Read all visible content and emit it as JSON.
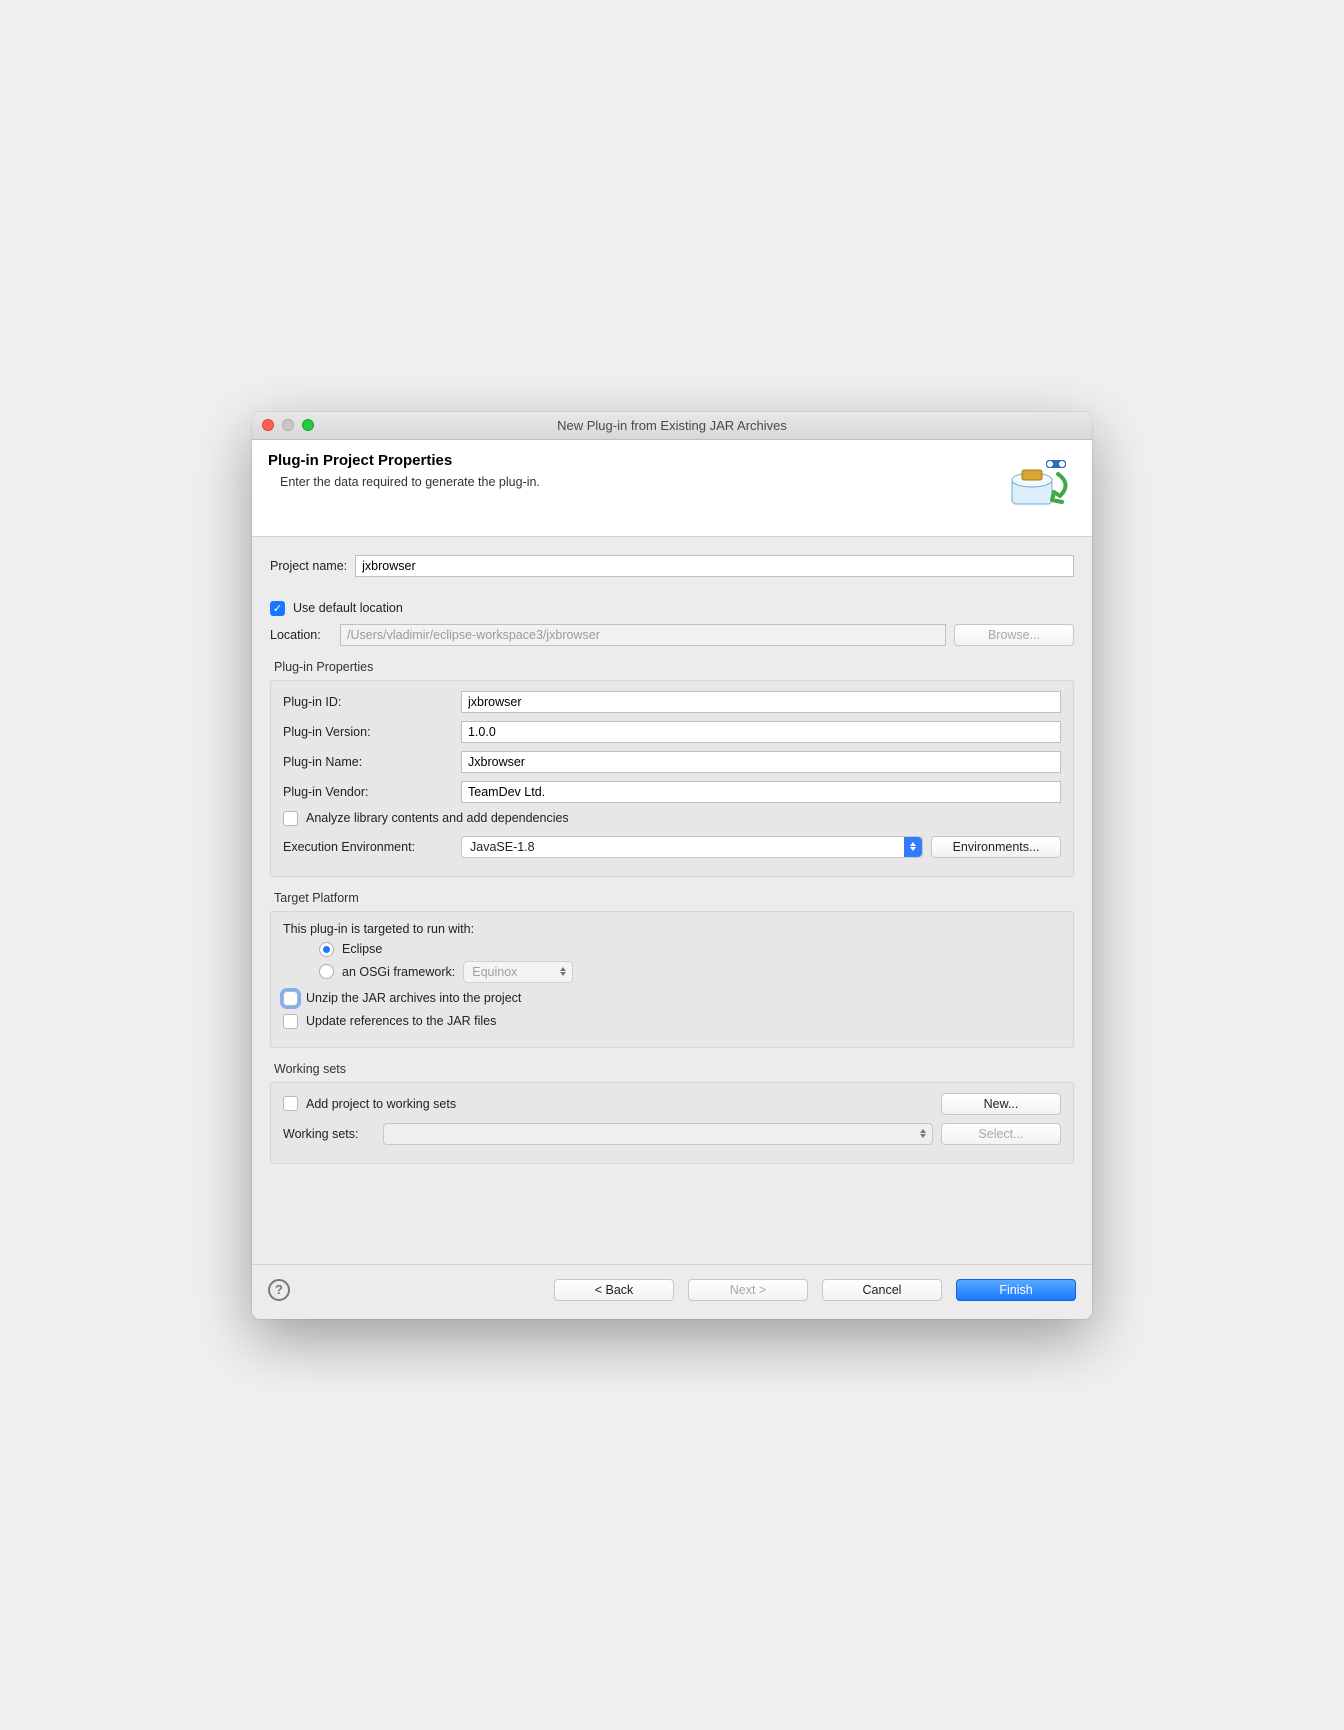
{
  "window": {
    "title": "New Plug-in from Existing JAR Archives"
  },
  "header": {
    "title": "Plug-in Project Properties",
    "subtitle": "Enter the data required to generate the plug-in."
  },
  "project": {
    "name_label": "Project name:",
    "name_value": "jxbrowser",
    "use_default_label": "Use default location",
    "location_label": "Location:",
    "location_value": "/Users/vladimir/eclipse-workspace3/jxbrowser",
    "browse_label": "Browse..."
  },
  "plugin_props": {
    "group_title": "Plug-in Properties",
    "id_label": "Plug-in ID:",
    "id_value": "jxbrowser",
    "version_label": "Plug-in Version:",
    "version_value": "1.0.0",
    "name_label": "Plug-in Name:",
    "name_value": "Jxbrowser",
    "vendor_label": "Plug-in Vendor:",
    "vendor_value": "TeamDev Ltd.",
    "analyze_label": "Analyze library contents and add dependencies",
    "ee_label": "Execution Environment:",
    "ee_value": "JavaSE-1.8",
    "environments_label": "Environments..."
  },
  "target": {
    "group_title": "Target Platform",
    "intro": "This plug-in is targeted to run with:",
    "eclipse_label": "Eclipse",
    "osgi_label": "an OSGi framework:",
    "osgi_value": "Equinox",
    "unzip_label": "Unzip the JAR archives into the project",
    "update_refs_label": "Update references to the JAR files"
  },
  "workingsets": {
    "group_title": "Working sets",
    "add_label": "Add project to working sets",
    "new_label": "New...",
    "ws_label": "Working sets:",
    "select_label": "Select..."
  },
  "footer": {
    "back": "< Back",
    "next": "Next >",
    "cancel": "Cancel",
    "finish": "Finish"
  }
}
